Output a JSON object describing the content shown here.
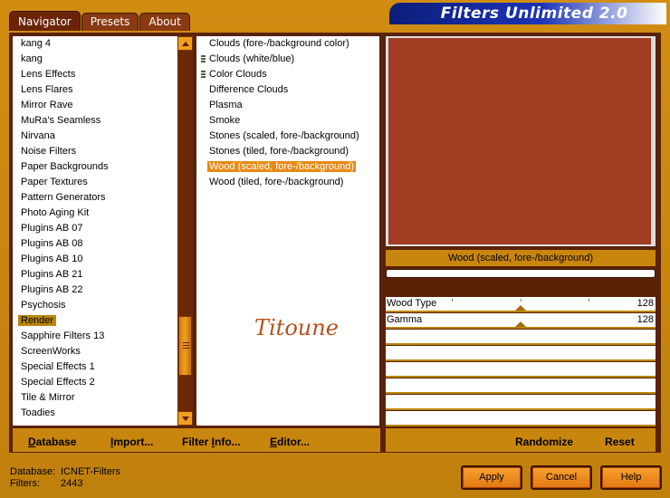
{
  "window": {
    "title": "Filters Unlimited 2.0"
  },
  "tabs": [
    {
      "label": "Navigator",
      "active": true
    },
    {
      "label": "Presets",
      "active": false
    },
    {
      "label": "About",
      "active": false
    }
  ],
  "categories": {
    "items": [
      "kang 4",
      "kang",
      "Lens Effects",
      "Lens Flares",
      "Mirror Rave",
      "MuRa's Seamless",
      "Nirvana",
      "Noise Filters",
      "Paper Backgrounds",
      "Paper Textures",
      "Pattern Generators",
      "Photo Aging Kit",
      "Plugins AB 07",
      "Plugins AB 08",
      "Plugins AB 10",
      "Plugins AB 21",
      "Plugins AB 22",
      "Psychosis",
      "Render",
      "Sapphire Filters 13",
      "ScreenWorks",
      "Special Effects 1",
      "Special Effects 2",
      "Tile & Mirror",
      "Toadies"
    ],
    "selected": "Render"
  },
  "filters": {
    "items": [
      {
        "label": "Clouds (fore-/background color)",
        "multi": false
      },
      {
        "label": "Clouds (white/blue)",
        "multi": true
      },
      {
        "label": "Color Clouds",
        "multi": true
      },
      {
        "label": "Difference Clouds",
        "multi": false
      },
      {
        "label": "Plasma",
        "multi": false
      },
      {
        "label": "Smoke",
        "multi": false
      },
      {
        "label": "Stones (scaled, fore-/background)",
        "multi": false
      },
      {
        "label": "Stones (tiled, fore-/background)",
        "multi": false
      },
      {
        "label": "Wood (scaled, fore-/background)",
        "multi": false
      },
      {
        "label": "Wood (tiled, fore-/background)",
        "multi": false
      }
    ],
    "selected": "Wood (scaled, fore-/background)",
    "watermark": "Titoune"
  },
  "preview": {
    "color": "#a23c22",
    "filter_name": "Wood (scaled, fore-/background)"
  },
  "parameters": [
    {
      "label": "Wood Type",
      "value": "128",
      "level": 0.5
    },
    {
      "label": "Gamma",
      "value": "128",
      "level": 0.5
    }
  ],
  "toolbar": {
    "database": {
      "u": "D",
      "rest": "atabase"
    },
    "import": {
      "u": "I",
      "rest": "mport..."
    },
    "filter_info": {
      "pre": "Filter ",
      "u": "I",
      "rest": "nfo..."
    },
    "editor": {
      "u": "E",
      "rest": "ditor..."
    },
    "randomize": "Randomize",
    "reset": "Reset"
  },
  "footer": {
    "database_label": "Database:",
    "database_value": "ICNET-Filters",
    "filters_label": "Filters:",
    "filters_value": "2443"
  },
  "buttons": {
    "apply": "Apply",
    "cancel": "Cancel",
    "help": "Help"
  },
  "colors": {
    "accent": "#c8860e",
    "dark": "#5a2206",
    "selection": "#e88a14"
  }
}
